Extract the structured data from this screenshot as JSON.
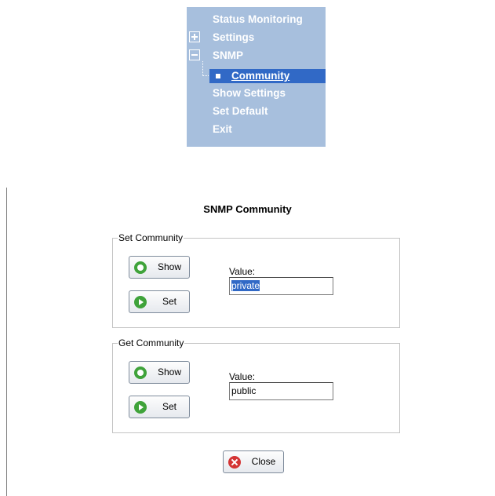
{
  "menu": {
    "items": [
      {
        "label": "Status Monitoring"
      },
      {
        "label": "Settings"
      },
      {
        "label": "SNMP"
      },
      {
        "label": "Community"
      },
      {
        "label": "Show Settings"
      },
      {
        "label": "Set Default"
      },
      {
        "label": "Exit"
      }
    ]
  },
  "page": {
    "title": "SNMP Community",
    "set_group": {
      "legend": "Set Community",
      "show_label": "Show",
      "set_label": "Set",
      "value_label": "Value:",
      "value": "private"
    },
    "get_group": {
      "legend": "Get Community",
      "show_label": "Show",
      "set_label": "Set",
      "value_label": "Value:",
      "value": "public"
    },
    "close_label": "Close"
  },
  "colors": {
    "menu_bg": "#a7bfdd",
    "menu_selected": "#3169c6",
    "button_icon_green": "#3fa33a",
    "close_icon_red": "#d43434"
  },
  "icons": [
    "expand-plus-icon",
    "collapse-minus-icon",
    "bullet-icon",
    "show-icon",
    "play-icon",
    "close-icon"
  ]
}
